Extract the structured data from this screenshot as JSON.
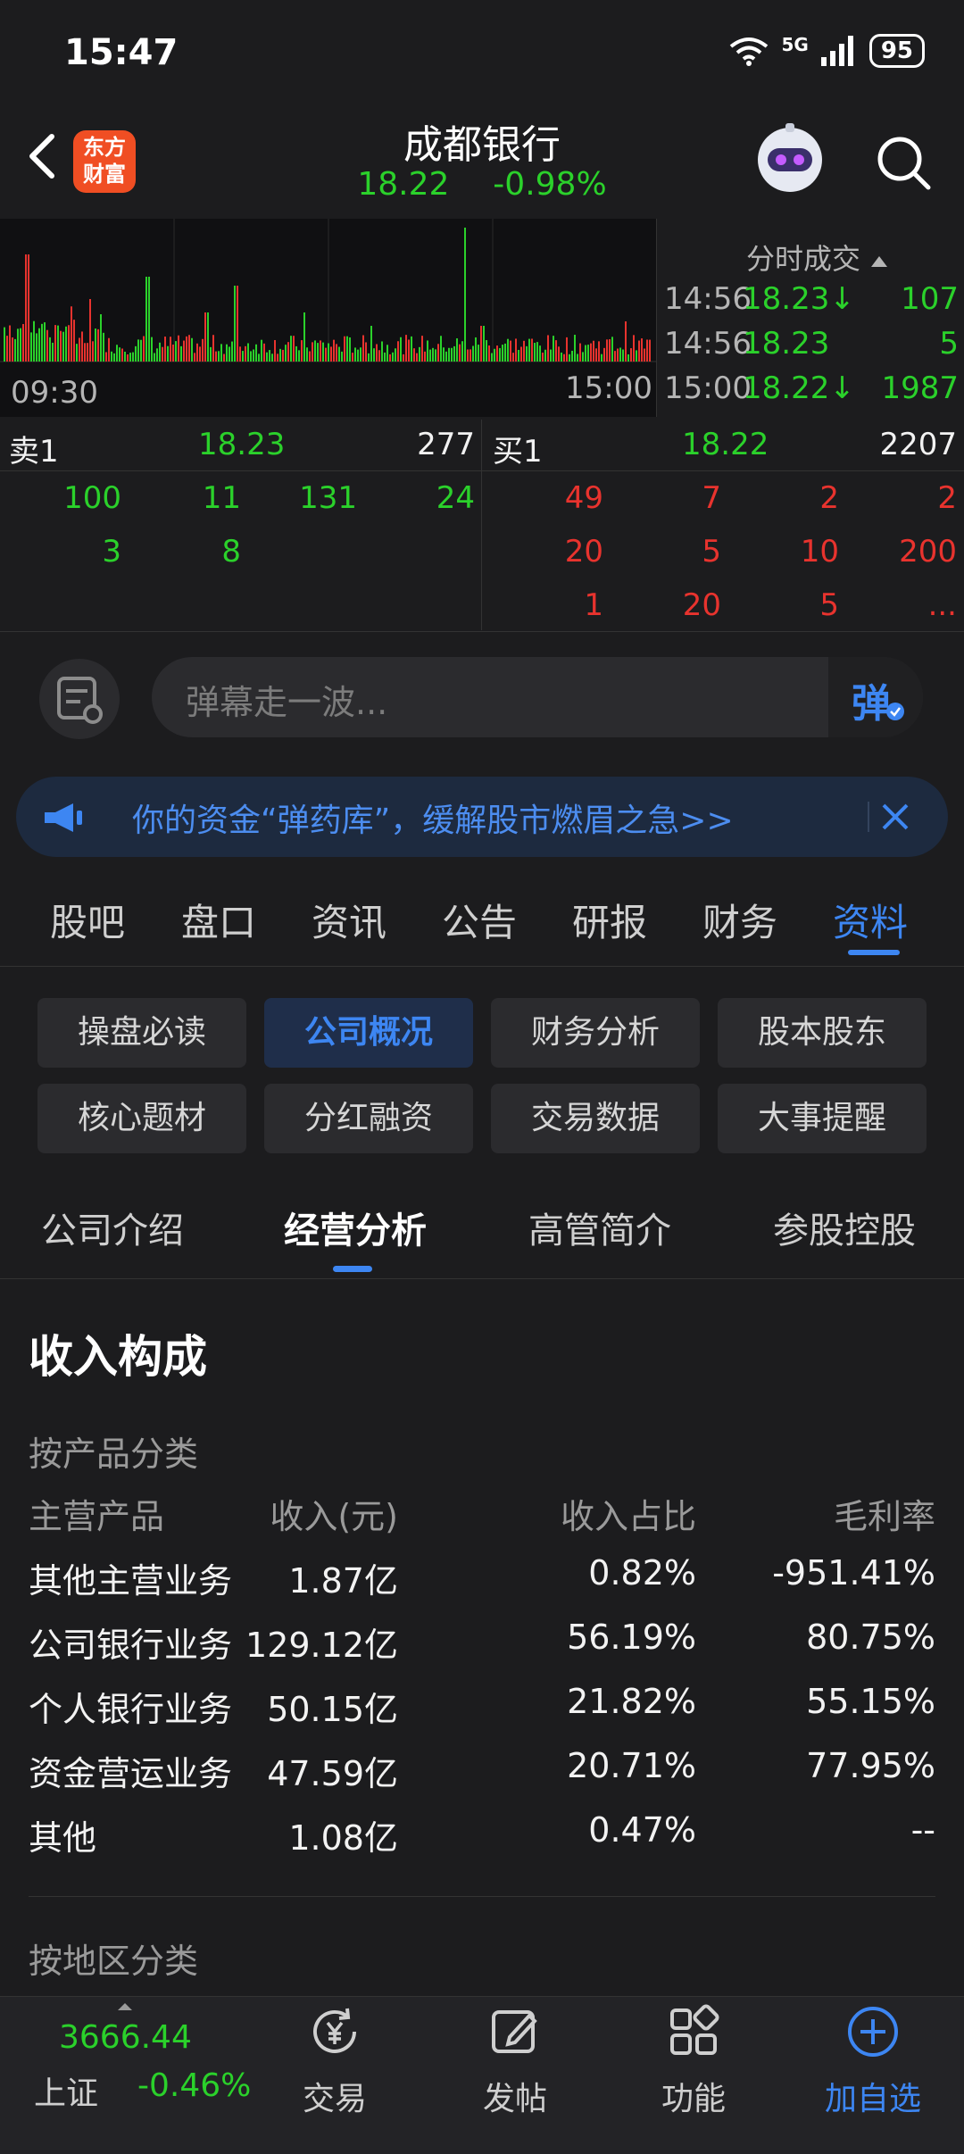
{
  "status_bar": {
    "time": "15:47",
    "network": "5G",
    "battery": "95"
  },
  "header": {
    "logo_line1": "东方",
    "logo_line2": "财富",
    "stock_name": "成都银行",
    "price": "18.22",
    "change": "-0.98%"
  },
  "chart": {
    "start_time": "09:30",
    "end_time": "15:00"
  },
  "trades": {
    "title": "分时成交",
    "rows": [
      {
        "time": "14:56",
        "price": "18.23↓",
        "volume": "107"
      },
      {
        "time": "14:56",
        "price": "18.23",
        "volume": "5"
      },
      {
        "time": "15:00",
        "price": "18.22↓",
        "volume": "1987"
      }
    ]
  },
  "order_book": {
    "sell_label": "卖1",
    "sell_price": "18.23",
    "sell_volume": "277",
    "buy_label": "买1",
    "buy_price": "18.22",
    "buy_volume": "2207",
    "sell_queue": [
      "100",
      "11",
      "131",
      "24",
      "3",
      "8"
    ],
    "buy_queue": [
      "49",
      "7",
      "2",
      "2",
      "20",
      "5",
      "10",
      "200",
      "1",
      "20",
      "5",
      "..."
    ]
  },
  "danmu": {
    "placeholder": "弹幕走一波...",
    "send_label": "弹"
  },
  "banner": {
    "text": "你的资金“弹药库”，缓解股市燃眉之急>>"
  },
  "main_tabs": [
    "股吧",
    "盘口",
    "资讯",
    "公告",
    "研报",
    "财务",
    "资料"
  ],
  "grid_buttons": [
    "操盘必读",
    "公司概况",
    "财务分析",
    "股本股东",
    "核心题材",
    "分红融资",
    "交易数据",
    "大事提醒"
  ],
  "sub_tabs": [
    "公司介绍",
    "经营分析",
    "高管简介",
    "参股控股"
  ],
  "content": {
    "section_title": "收入构成",
    "category_product": "按产品分类",
    "headers": [
      "主营产品",
      "收入(元)",
      "收入占比",
      "毛利率"
    ],
    "rows": [
      [
        "其他主营业务",
        "1.87亿",
        "0.82%",
        "-951.41%"
      ],
      [
        "公司银行业务",
        "129.12亿",
        "56.19%",
        "80.75%"
      ],
      [
        "个人银行业务",
        "50.15亿",
        "21.82%",
        "55.15%"
      ],
      [
        "资金营运业务",
        "47.59亿",
        "20.71%",
        "77.95%"
      ],
      [
        "其他",
        "1.08亿",
        "0.47%",
        "--"
      ]
    ],
    "category_region": "按地区分类"
  },
  "bottom_nav": {
    "index_value": "3666.44",
    "index_name": "上证",
    "index_change": "-0.46%",
    "items": [
      "交易",
      "发帖",
      "功能",
      "加自选"
    ]
  }
}
